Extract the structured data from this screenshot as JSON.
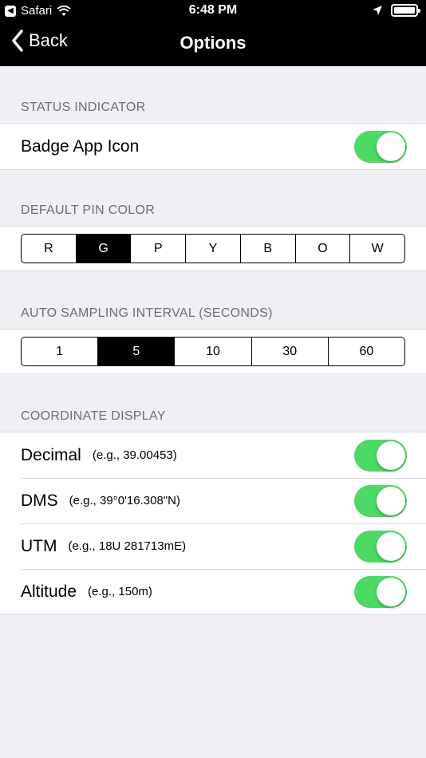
{
  "status_bar": {
    "back_app": "Safari",
    "time": "6:48 PM"
  },
  "nav": {
    "back_label": "Back",
    "title": "Options"
  },
  "status_indicator": {
    "header": "STATUS INDICATOR",
    "badge_label": "Badge App Icon",
    "badge_on": true
  },
  "pin_color": {
    "header": "DEFAULT PIN COLOR",
    "options": [
      "R",
      "G",
      "P",
      "Y",
      "B",
      "O",
      "W"
    ],
    "selected": "G"
  },
  "sampling": {
    "header": "AUTO SAMPLING INTERVAL (SECONDS)",
    "options": [
      "1",
      "5",
      "10",
      "30",
      "60"
    ],
    "selected": "5"
  },
  "coordinates": {
    "header": "COORDINATE DISPLAY",
    "items": [
      {
        "label": "Decimal",
        "hint": "(e.g., 39.00453)",
        "on": true
      },
      {
        "label": "DMS",
        "hint": "(e.g., 39°0'16.308\"N)",
        "on": true
      },
      {
        "label": "UTM",
        "hint": "(e.g., 18U 281713mE)",
        "on": true
      },
      {
        "label": "Altitude",
        "hint": "(e.g., 150m)",
        "on": true
      }
    ]
  },
  "colors": {
    "toggle_on": "#4cd964",
    "nav_background": "#000000",
    "page_background": "#efeff4"
  }
}
